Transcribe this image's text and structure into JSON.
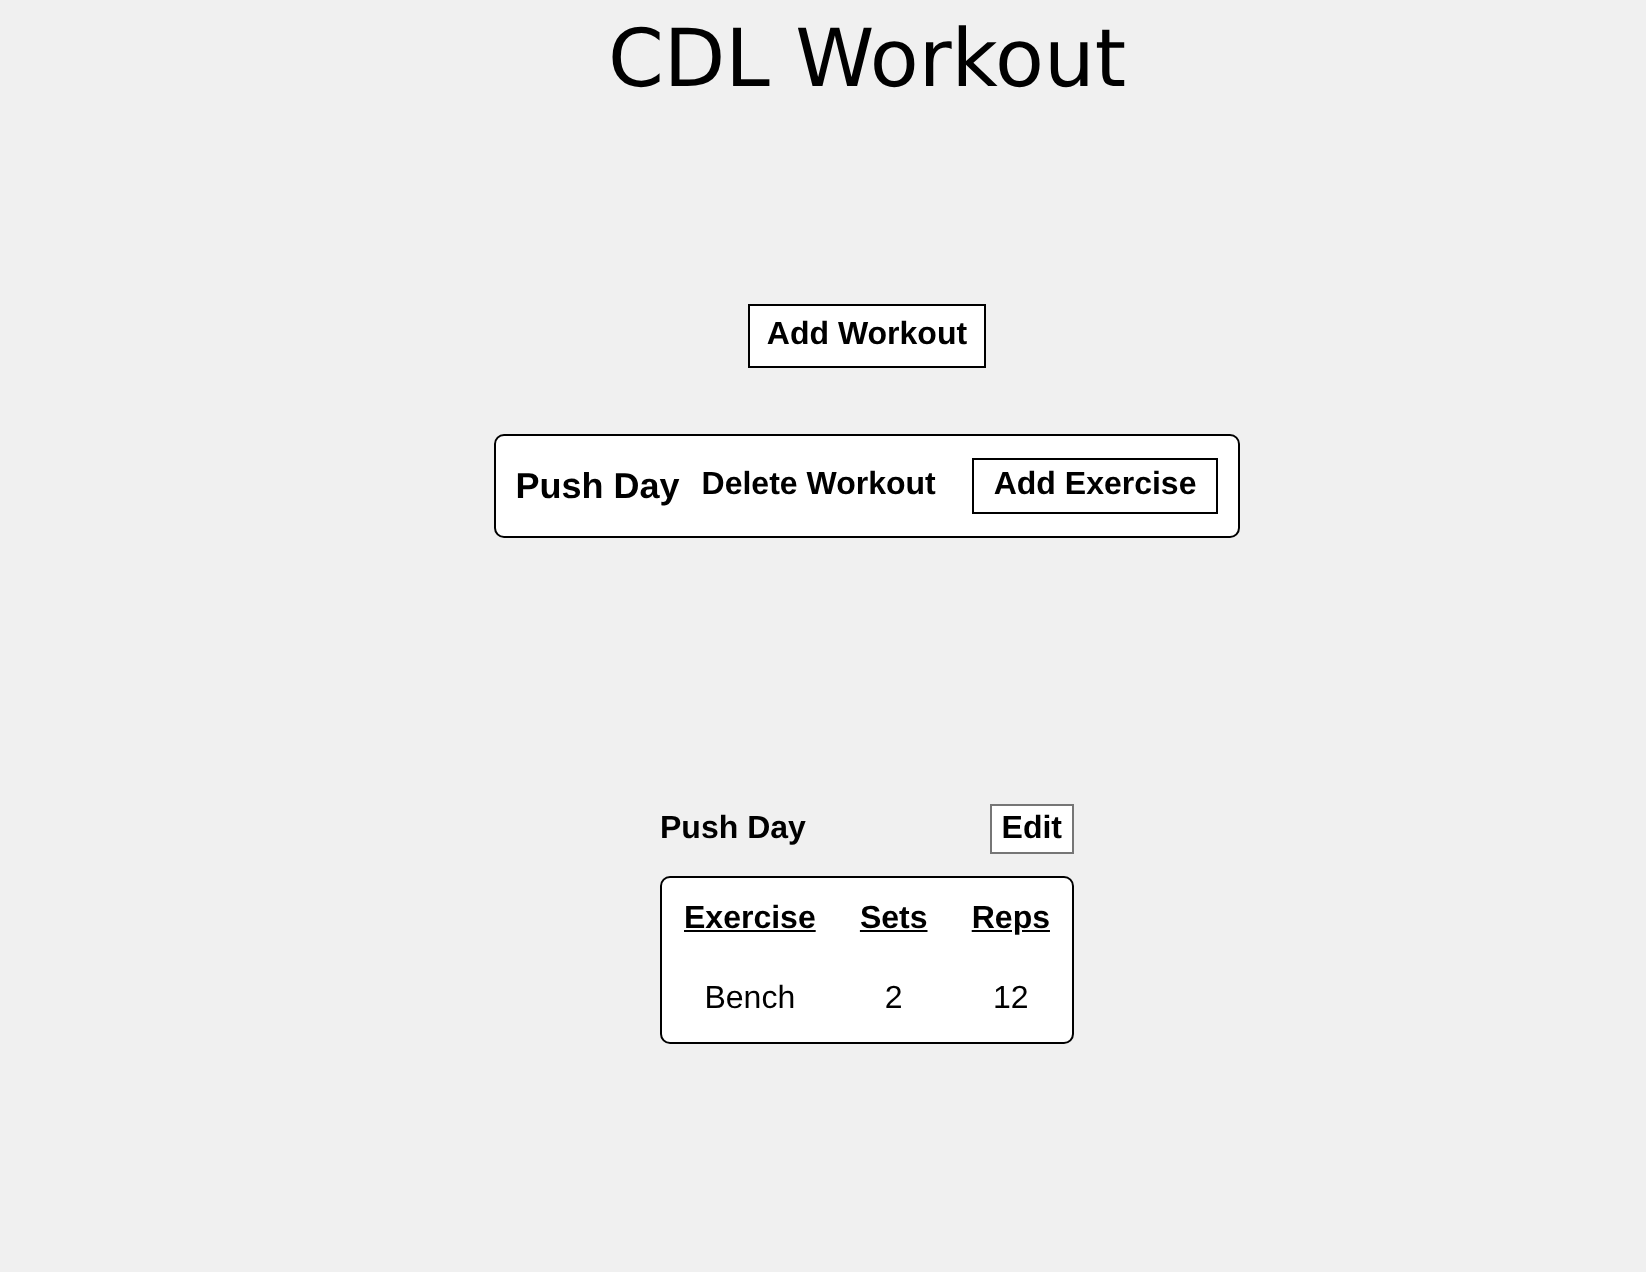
{
  "title": "CDL Workout",
  "add_workout_button": "Add Workout",
  "workouts": [
    {
      "name": "Push Day",
      "delete_label": "Delete Workout",
      "add_exercise_label": "Add Exercise"
    }
  ],
  "detail": {
    "title": "Push Day",
    "edit_button": "Edit",
    "table": {
      "columns": [
        "Exercise",
        "Sets",
        "Reps"
      ],
      "rows": [
        [
          "Bench",
          "2",
          "12"
        ]
      ]
    }
  }
}
